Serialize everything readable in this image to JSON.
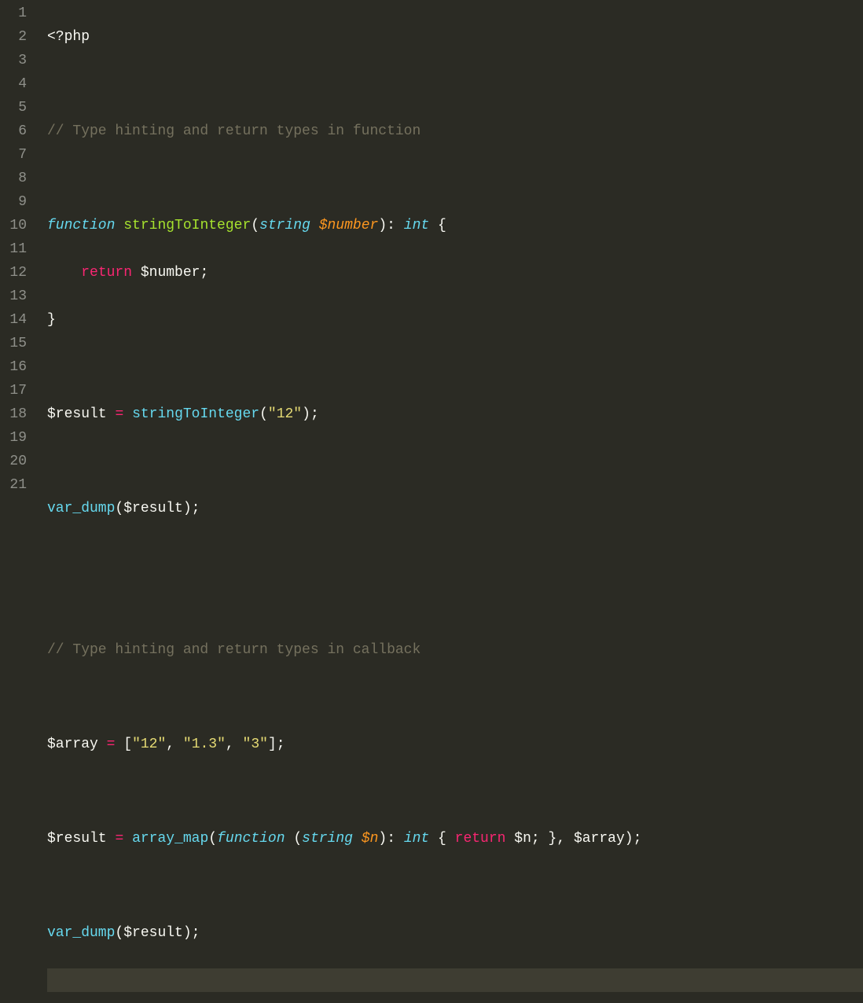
{
  "lineNumbers": [
    "1",
    "2",
    "3",
    "4",
    "5",
    "6",
    "7",
    "8",
    "9",
    "10",
    "11",
    "12",
    "13",
    "14",
    "15",
    "16",
    "17",
    "18",
    "19",
    "20",
    "21"
  ],
  "currentLine": 21,
  "code": {
    "l1": {
      "open": "<?php"
    },
    "l3": {
      "comment": "// Type hinting and return types in function"
    },
    "l5": {
      "kw": "function",
      "name": "stringToInteger",
      "lp": "(",
      "ptype": "string",
      "pvar": "$number",
      "rp": ")",
      "colon": ":",
      "rtype": "int",
      "brace": "{"
    },
    "l6": {
      "ret": "return",
      "var": "$number",
      "semi": ";"
    },
    "l7": {
      "brace": "}"
    },
    "l9": {
      "var": "$result",
      "eq": "=",
      "fn": "stringToInteger",
      "lp": "(",
      "arg": "\"12\"",
      "rp": ")",
      "semi": ";"
    },
    "l11": {
      "fn": "var_dump",
      "lp": "(",
      "var": "$result",
      "rp": ")",
      "semi": ";"
    },
    "l14": {
      "comment": "// Type hinting and return types in callback"
    },
    "l16": {
      "var": "$array",
      "eq": "=",
      "lb": "[",
      "a1": "\"12\"",
      "c1": ",",
      "a2": "\"1.3\"",
      "c2": ",",
      "a3": "\"3\"",
      "rb": "]",
      "semi": ";"
    },
    "l18": {
      "var": "$result",
      "eq": "=",
      "fn": "array_map",
      "lp": "(",
      "kw": "function",
      "lp2": "(",
      "ptype": "string",
      "pvar": "$n",
      "rp2": ")",
      "colon": ":",
      "rtype": "int",
      "lb": "{",
      "ret": "return",
      "rvar": "$n",
      "semi1": ";",
      "rb": "}",
      "c": ",",
      "arr": "$array",
      "rp": ")",
      "semi": ";"
    },
    "l20": {
      "fn": "var_dump",
      "lp": "(",
      "var": "$result",
      "rp": ")",
      "semi": ";"
    }
  }
}
